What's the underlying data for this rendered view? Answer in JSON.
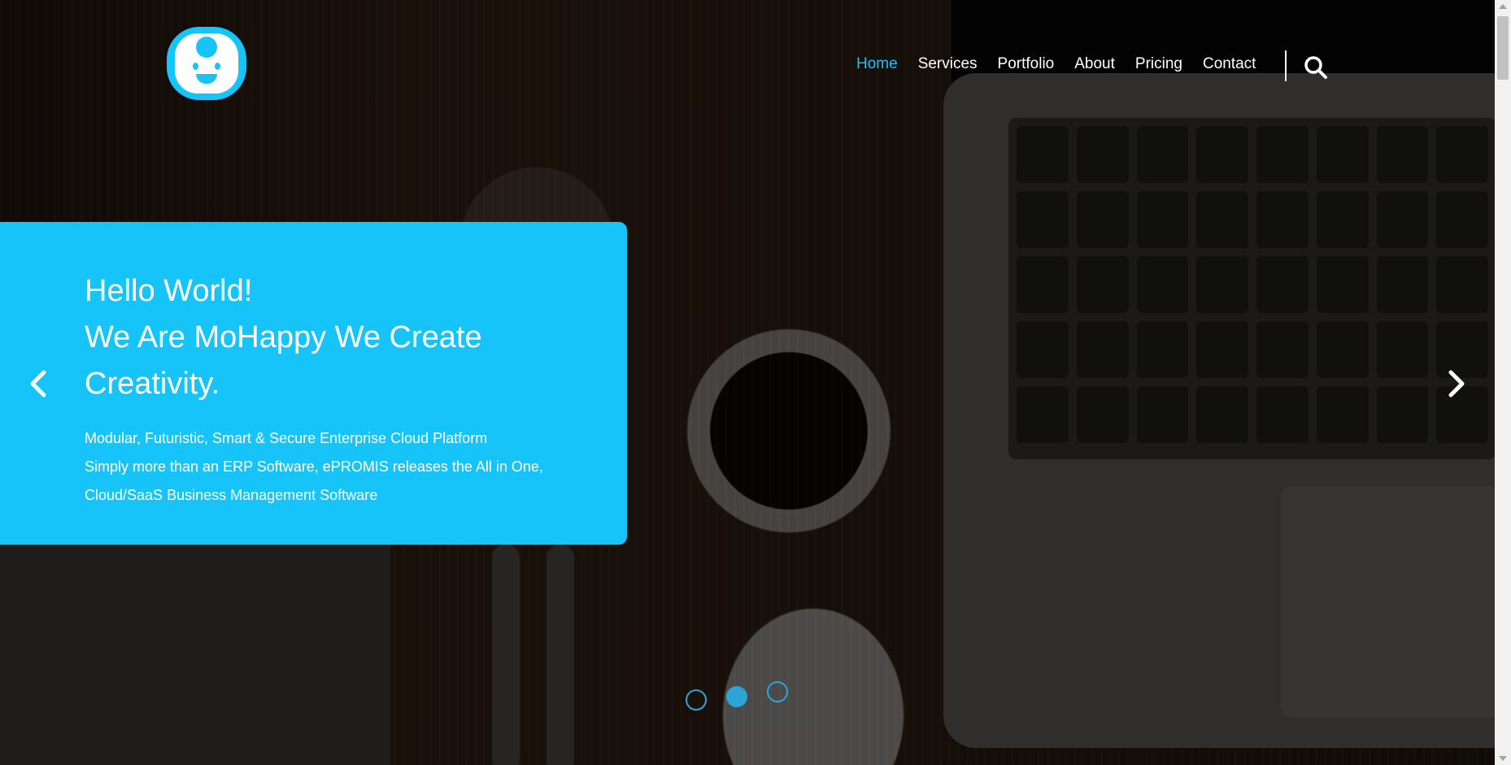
{
  "nav": {
    "items": [
      {
        "label": "Home",
        "active": true
      },
      {
        "label": "Services",
        "active": false
      },
      {
        "label": "Portfolio",
        "active": false
      },
      {
        "label": "About",
        "active": false
      },
      {
        "label": "Pricing",
        "active": false
      },
      {
        "label": "Contact",
        "active": false
      }
    ]
  },
  "hero": {
    "title_lines": [
      "Hello World!",
      "We Are MoHappy We Create",
      "Creativity."
    ],
    "text_lines": [
      "Modular, Futuristic, Smart & Secure Enterprise Cloud Platform",
      "Simply more than an ERP Software, ePROMIS releases the All in One,",
      "Cloud/SaaS Business Management Software"
    ]
  },
  "slider": {
    "total_slides": 3,
    "active_slide": 2
  },
  "colors": {
    "accent": "#17c4f9",
    "dot": "#2aa5d6",
    "nav_text": "#ffffff"
  },
  "icons": {
    "logo": "smiley-face-logo",
    "search": "search-icon",
    "prev": "chevron-left-icon",
    "next": "chevron-right-icon"
  }
}
